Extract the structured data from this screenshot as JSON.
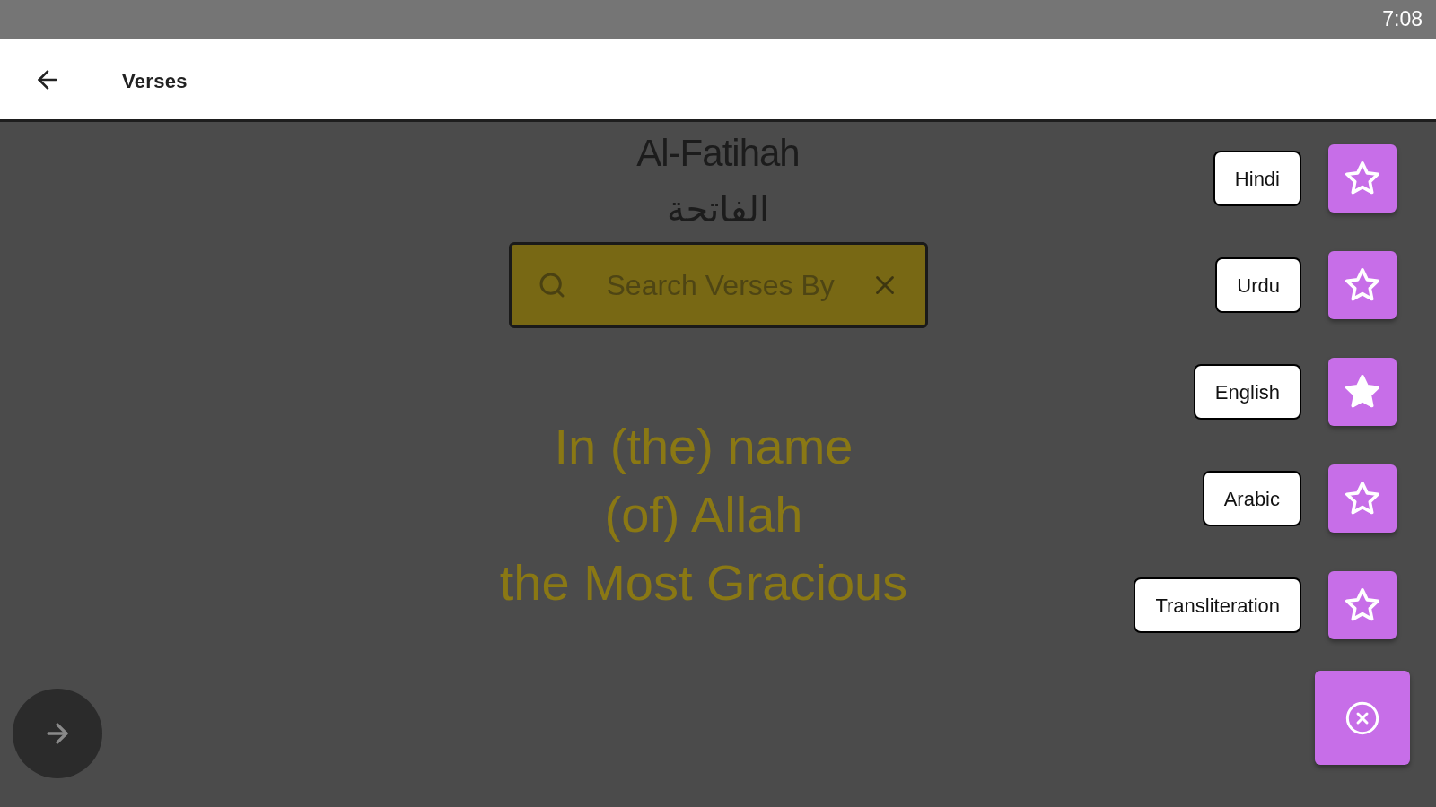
{
  "status_bar": {
    "time": "7:08"
  },
  "app_bar": {
    "title": "Verses"
  },
  "surah": {
    "name": "Al-Fatihah",
    "arabic_name": "الفاتحة"
  },
  "search": {
    "placeholder": "Search Verses By"
  },
  "verse": {
    "lines": [
      "In (the) name",
      "(of) Allah",
      "the Most Gracious"
    ]
  },
  "language_options": [
    {
      "label": "Hindi",
      "selected": false
    },
    {
      "label": "Urdu",
      "selected": false
    },
    {
      "label": "English",
      "selected": true
    },
    {
      "label": "Arabic",
      "selected": false
    },
    {
      "label": "Transliteration",
      "selected": false
    }
  ]
}
